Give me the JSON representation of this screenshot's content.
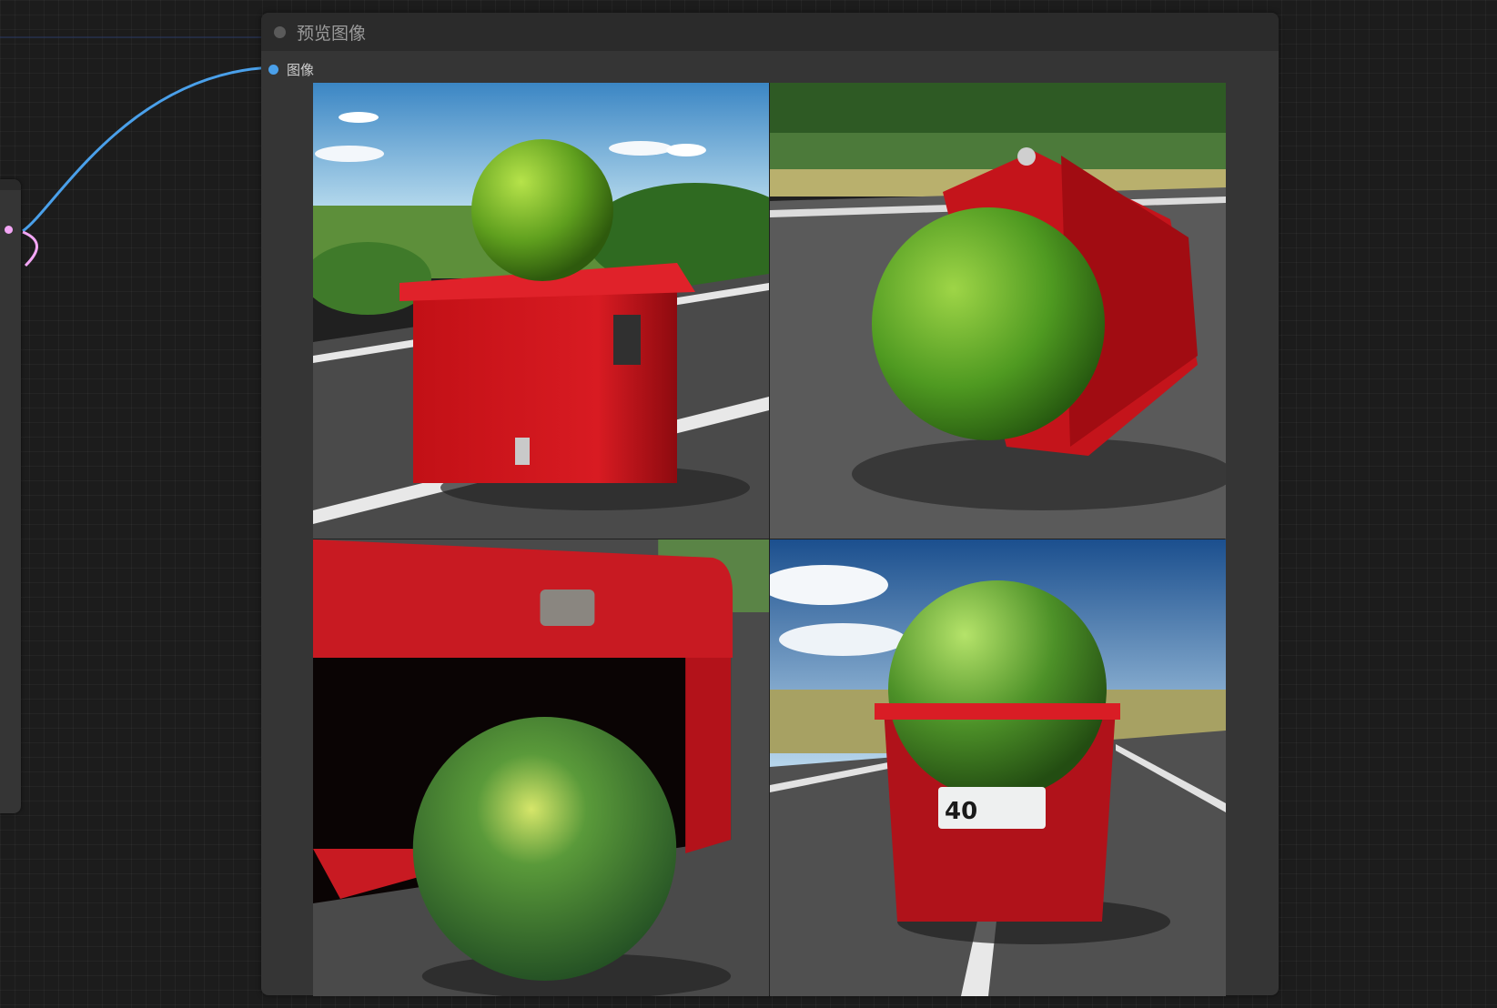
{
  "node": {
    "title": "预览图像",
    "input_label": "图像"
  },
  "images": [
    {
      "name": "preview-image-1"
    },
    {
      "name": "preview-image-2"
    },
    {
      "name": "preview-image-3"
    },
    {
      "name": "preview-image-4"
    },
    {
      "label_number": "40"
    }
  ],
  "colors": {
    "canvas": "#1c1c1c",
    "node_body": "#353535",
    "node_header": "#2b2b2b",
    "image_wire": "#4aa0ea",
    "latent_wire": "#f3a6f5",
    "text": "#9a9a9a"
  }
}
